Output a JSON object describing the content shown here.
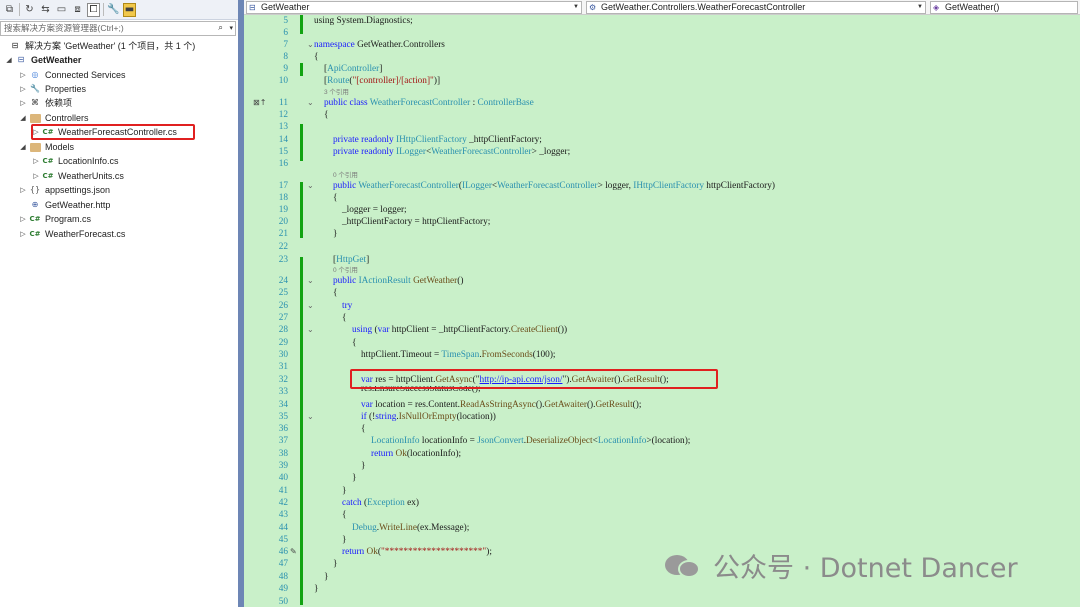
{
  "solution_explorer": {
    "search_placeholder": "搜索解决方案资源管理器(Ctrl+;)",
    "solution_label": "解决方案 'GetWeather' (1 个项目，共 1 个)",
    "project": "GetWeather",
    "items": [
      {
        "label": "Connected Services"
      },
      {
        "label": "Properties"
      },
      {
        "label": "依赖项"
      },
      {
        "label": "Controllers"
      },
      {
        "label": "WeatherForecastController.cs"
      },
      {
        "label": "Models"
      },
      {
        "label": "LocationInfo.cs"
      },
      {
        "label": "WeatherUnits.cs"
      },
      {
        "label": "appsettings.json"
      },
      {
        "label": "GetWeather.http"
      },
      {
        "label": "Program.cs"
      },
      {
        "label": "WeatherForecast.cs"
      }
    ]
  },
  "editor": {
    "nav_project": "GetWeather",
    "nav_class": "GetWeather.Controllers.WeatherForecastController",
    "nav_member": "GetWeather()",
    "refs": {
      "three": "3 个引用",
      "zero": "0 个引用"
    },
    "line_numbers": [
      "5",
      "6",
      "7",
      "8",
      "9",
      "10",
      "11",
      "12",
      "13",
      "14",
      "15",
      "16",
      "17",
      "18",
      "19",
      "20",
      "21",
      "22",
      "23",
      "24",
      "25",
      "26",
      "27",
      "28",
      "29",
      "30",
      "31",
      "32",
      "33",
      "34",
      "35",
      "36",
      "37",
      "38",
      "39",
      "40",
      "41",
      "42",
      "43",
      "44",
      "45",
      "46",
      "47",
      "48",
      "49",
      "50"
    ],
    "code": {
      "l5": "using System.Diagnostics;",
      "l7a": "namespace",
      "l7b": " GetWeather.Controllers",
      "l8": "{",
      "l9a": "[",
      "l9b": "ApiController",
      "l9c": "]",
      "l10a": "[",
      "l10b": "Route",
      "l10c": "(",
      "l10d": "\"[controller]/[action]\"",
      "l10e": ")]",
      "l11a": "public class ",
      "l11b": "WeatherForecastController",
      "l11c": " : ",
      "l11d": "ControllerBase",
      "l12": "{",
      "l14a": "private readonly ",
      "l14b": "IHttpClientFactory",
      "l14c": " _httpClientFactory;",
      "l15a": "private readonly ",
      "l15b": "ILogger",
      "l15c": "<",
      "l15d": "WeatherForecastController",
      "l15e": "> _logger;",
      "l17a": "public ",
      "l17b": "WeatherForecastController",
      "l17c": "(",
      "l17d": "ILogger",
      "l17e": "<",
      "l17f": "WeatherForecastController",
      "l17g": "> logger, ",
      "l17h": "IHttpClientFactory",
      "l17i": " httpClientFactory)",
      "l18": "{",
      "l19": "_logger = logger;",
      "l20": "_httpClientFactory = httpClientFactory;",
      "l21": "}",
      "l23a": "[",
      "l23b": "HttpGet",
      "l23c": "]",
      "l24a": "public ",
      "l24b": "IActionResult",
      "l24c": " ",
      "l24d": "GetWeather",
      "l24e": "()",
      "l25": "{",
      "l26": "try",
      "l27": "{",
      "l28a": "using",
      "l28b": " (",
      "l28c": "var",
      "l28d": " httpClient = _httpClientFactory.",
      "l28e": "CreateClient",
      "l28f": "())",
      "l29": "{",
      "l30a": "httpClient.Timeout = ",
      "l30b": "TimeSpan",
      "l30c": ".",
      "l30d": "FromSeconds",
      "l30e": "(100);",
      "l32a": "var",
      "l32b": " res = httpClient.",
      "l32c": "GetAsync",
      "l32d": "(\"",
      "l32e": "http://ip-api.com/json/",
      "l32f": "\").",
      "l32g": "GetAwaiter",
      "l32h": "().",
      "l32i": "GetResult",
      "l32j": "();",
      "l33": "res.EnsureSuccessStatusCode();",
      "l34a": "var",
      "l34b": " location = res.Content.",
      "l34c": "ReadAsStringAsync",
      "l34d": "().",
      "l34e": "GetAwaiter",
      "l34f": "().",
      "l34g": "GetResult",
      "l34h": "();",
      "l35a": "if",
      "l35b": " (!",
      "l35c": "string",
      "l35d": ".",
      "l35e": "IsNullOrEmpty",
      "l35f": "(location))",
      "l36": "{",
      "l37a": "LocationInfo",
      "l37b": " locationInfo = ",
      "l37c": "JsonConvert",
      "l37d": ".",
      "l37e": "DeserializeObject",
      "l37f": "<",
      "l37g": "LocationInfo",
      "l37h": ">(location);",
      "l38a": "return",
      "l38b": " ",
      "l38c": "Ok",
      "l38d": "(locationInfo);",
      "l39": "}",
      "l40": "}",
      "l41": "}",
      "l42a": "catch",
      "l42b": " (",
      "l42c": "Exception",
      "l42d": " ex)",
      "l43": "{",
      "l44a": "Debug",
      "l44b": ".",
      "l44c": "WriteLine",
      "l44d": "(ex.Message);",
      "l45": "}",
      "l46a": "return",
      "l46b": " ",
      "l46c": "Ok",
      "l46d": "(",
      "l46e": "\"*********************\"",
      "l46f": ");",
      "l47": "}",
      "l48": "}",
      "l49": "}"
    }
  },
  "watermark": "公众号 · Dotnet Dancer"
}
